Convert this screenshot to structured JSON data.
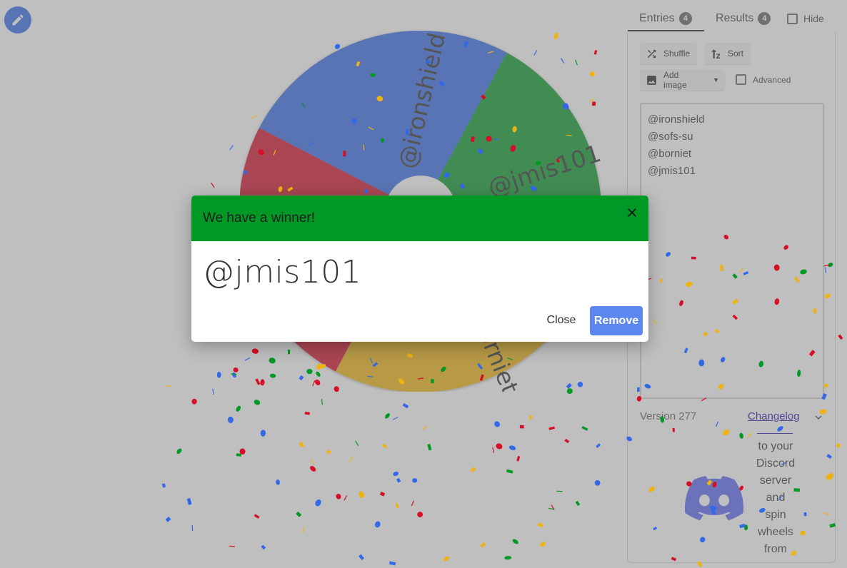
{
  "edit_fab": {
    "icon": "pencil-icon",
    "color": "#3369e8"
  },
  "wheel": {
    "colors": {
      "blue": "#3369e8",
      "green": "#009925",
      "red": "#d50f25",
      "yellow": "#eeb211"
    },
    "segments": [
      {
        "label": "@ironshield",
        "color": "#3369e8"
      },
      {
        "label": "@jmis101",
        "color": "#009925"
      },
      {
        "label": "@borniet",
        "color": "#eeb211"
      },
      {
        "label": "@sofs-su",
        "color": "#d50f25"
      }
    ]
  },
  "tabs": {
    "entries_label": "Entries",
    "entries_count": "4",
    "results_label": "Results",
    "results_count": "4",
    "hide_label": "Hide"
  },
  "toolbar": {
    "shuffle_label": "Shuffle",
    "sort_label": "Sort",
    "add_image_label": "Add image",
    "advanced_label": "Advanced"
  },
  "entries": [
    "@ironshield",
    "@sofs-su",
    "@borniet",
    "@jmis101"
  ],
  "footer": {
    "version": "Version 277",
    "changelog": "Changelog",
    "discord_lines": [
      "to your",
      "Discord",
      "server",
      "and",
      "spin",
      "wheels",
      "from"
    ]
  },
  "dialog": {
    "title": "We have a winner!",
    "winner": "@jmis101",
    "close_label": "Close",
    "remove_label": "Remove",
    "header_color": "#009925",
    "remove_color": "#5b87ee"
  }
}
